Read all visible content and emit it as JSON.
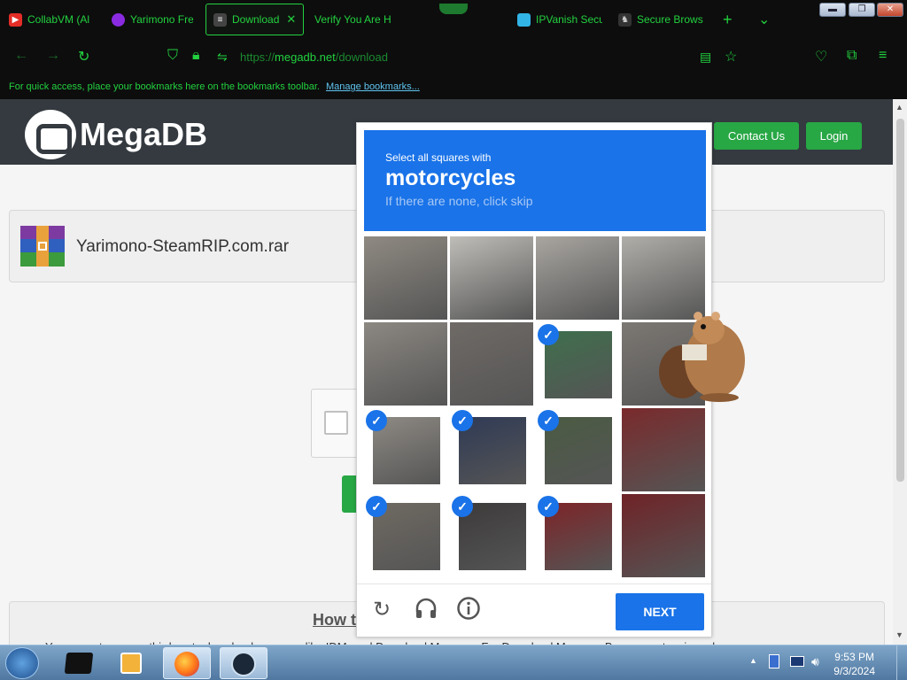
{
  "browser": {
    "tabs": [
      {
        "label": "CollabVM (Al",
        "icon": "youtube-icon",
        "color": "#e52d27"
      },
      {
        "label": "Yarimono Fre",
        "icon": "purple-swirl-icon",
        "color": "#8a2be2"
      },
      {
        "label": "Download",
        "icon": "database-icon",
        "color": "#dddddd"
      },
      {
        "label": "Verify You Are H",
        "icon": "",
        "color": ""
      },
      {
        "label": "IPVanish Secu",
        "icon": "ipvanish-icon",
        "color": "#32b4e6"
      },
      {
        "label": "Secure Brows",
        "icon": "secure-browser-icon",
        "color": "#cccccc"
      }
    ],
    "active_tab_close": "✕",
    "new_tab": "+",
    "tab_list": "⌄",
    "url_prefix": "https://",
    "url_host": "megadb.net",
    "url_path": "/download",
    "bookmarks_text": "For quick access, place your bookmarks here on the bookmarks toolbar.",
    "bookmarks_link": "Manage bookmarks...",
    "window_buttons": {
      "minimize": "▬",
      "restore": "❐",
      "close": "✕"
    }
  },
  "site": {
    "logo_text": "MegaDB",
    "contact_label": "Contact Us",
    "login_label": "Login",
    "file_name": "Yarimono-SteamRIP.com.rar",
    "how_title": "How t",
    "how_text": "You cannot use any third-party download manager like IDM, and Download Manager. For Download Manager Browser extension, please"
  },
  "captcha": {
    "instruction": "Select all squares with",
    "target": "motorcycles",
    "hint": "If there are none, click skip",
    "next_label": "NEXT",
    "check_glyph": "✓",
    "cells": [
      {
        "selected": false,
        "bg": "#8f8a82"
      },
      {
        "selected": false,
        "bg": "#bfbdb8"
      },
      {
        "selected": false,
        "bg": "#a9a6a1"
      },
      {
        "selected": false,
        "bg": "#b0aea9"
      },
      {
        "selected": false,
        "bg": "#8c8882"
      },
      {
        "selected": false,
        "bg": "#6f6a66"
      },
      {
        "selected": true,
        "bg": "#3f6f4d"
      },
      {
        "selected": false,
        "bg": "#7c7873"
      },
      {
        "selected": true,
        "bg": "#8e8a84"
      },
      {
        "selected": true,
        "bg": "#2f3a55"
      },
      {
        "selected": true,
        "bg": "#4a5b43"
      },
      {
        "selected": false,
        "bg": "#7a2a2c"
      },
      {
        "selected": true,
        "bg": "#6f6a62"
      },
      {
        "selected": true,
        "bg": "#3d3a3a"
      },
      {
        "selected": true,
        "bg": "#7d2428"
      },
      {
        "selected": false,
        "bg": "#6f2327"
      }
    ],
    "footer_icons": [
      "reload-icon",
      "audio-headphones-icon",
      "info-icon"
    ]
  },
  "taskbar": {
    "time": "9:53 PM",
    "date": "9/3/2024"
  }
}
